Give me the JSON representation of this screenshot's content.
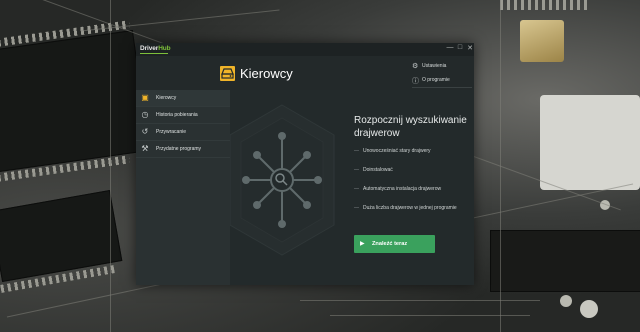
{
  "app": {
    "logo_prefix": "Driver",
    "logo_suffix": "Hub"
  },
  "window_controls": {
    "minimize": "—",
    "maximize": "□",
    "close": "✕"
  },
  "header": {
    "title": "Kierowcy",
    "title_icon": "driver-box-icon",
    "settings_label": "Ustawienia",
    "settings_icon": "gear-icon",
    "about_label": "O programie",
    "about_icon": "info-icon"
  },
  "sidebar": {
    "items": [
      {
        "label": "Kierowcy",
        "icon": "driver-box-icon",
        "glyph": "▣",
        "active": true
      },
      {
        "label": "Historia pobierania",
        "icon": "download-history-icon",
        "glyph": "◷",
        "active": false
      },
      {
        "label": "Przywracanie",
        "icon": "restore-icon",
        "glyph": "↺",
        "active": false
      },
      {
        "label": "Przydatne programy",
        "icon": "tools-icon",
        "glyph": "⚒",
        "active": false
      }
    ]
  },
  "main": {
    "heading": "Rozpocznij wyszukiwanie drajwerow",
    "bullets": [
      "Unowocześniać stary drajwery",
      "Doinstalować",
      "Automatyczna instalacja drajwerow",
      "Duża liczba drajwerow w jednej programie"
    ],
    "scan_button": "Znaleźć teraz",
    "scan_icon": "play-icon",
    "illustration_icon": "driver-network-icon"
  },
  "colors": {
    "accent_yellow": "#f0b429",
    "accent_green": "#3aa15d",
    "brand_green": "#7dbf3a",
    "window_bg": "#23292a",
    "sidebar_bg": "#2a3132"
  }
}
